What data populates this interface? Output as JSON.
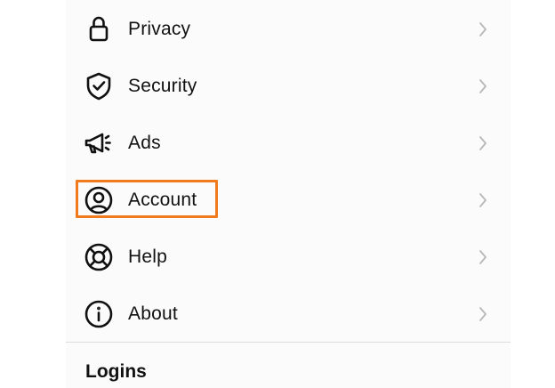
{
  "settings": {
    "items": [
      {
        "label": "Privacy",
        "icon": "lock-icon"
      },
      {
        "label": "Security",
        "icon": "shield-check-icon"
      },
      {
        "label": "Ads",
        "icon": "megaphone-icon"
      },
      {
        "label": "Account",
        "icon": "user-circle-icon"
      },
      {
        "label": "Help",
        "icon": "lifebuoy-icon"
      },
      {
        "label": "About",
        "icon": "info-icon"
      }
    ],
    "highlighted_item": "Account",
    "highlight_color": "#f07a1c",
    "chevron_icon": "chevron-right-icon"
  },
  "logins_section": {
    "title": "Logins"
  }
}
